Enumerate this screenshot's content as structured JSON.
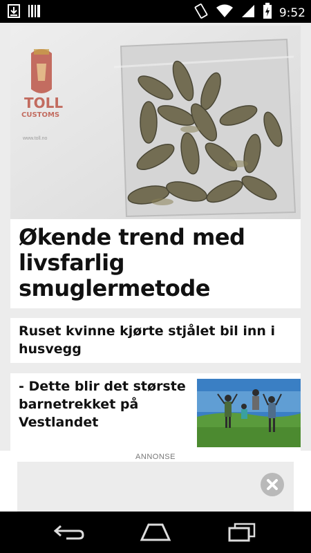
{
  "status_bar": {
    "time": "9:52",
    "icons": [
      "download-icon",
      "barcode-icon",
      "rotate-icon",
      "wifi-icon",
      "signal-icon",
      "battery-icon"
    ]
  },
  "feed": {
    "hero": {
      "title": "Økende trend med livsfarlig smuglermetode",
      "image": {
        "logo_text_1": "TOLL",
        "logo_text_2": "CUSTOMS",
        "logo_url_text": "www.toll.no"
      }
    },
    "articles": [
      {
        "title": "Ruset kvinne kjørte stjålet bil inn i husvegg"
      },
      {
        "title": "- Dette blir det største barnetrekket på Vestlandet",
        "thumbnail": "group-jumping-photo"
      }
    ]
  },
  "ad": {
    "label": "ANNONSE",
    "close_icon": "close-icon"
  },
  "nav_bar": {
    "buttons": [
      "back-icon",
      "home-icon",
      "recents-icon"
    ]
  },
  "colors": {
    "background": "#ececec",
    "card": "#ffffff",
    "title_text": "#111111",
    "status_bar": "#000000"
  }
}
